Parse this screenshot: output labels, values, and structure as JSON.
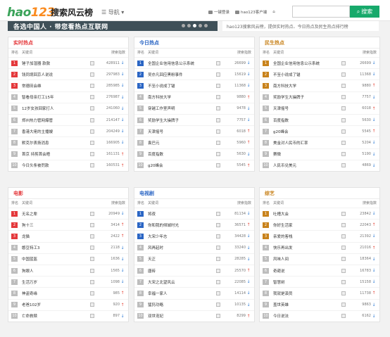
{
  "header": {
    "logo_text": "hao",
    "logo_number": "123",
    "site_title": "搜索风云榜",
    "nav_label": "导航",
    "links": [
      "一键登录",
      "hao123客户端"
    ],
    "search_placeholder": "",
    "search_button": "搜索"
  },
  "banner": {
    "text": "各选中国人 · 带您看热点互联网"
  },
  "notice": {
    "text": "hao123搜索风云榜，提供实时热点、今日热点及民生热点排行榜"
  },
  "columns": {
    "rank": "排名",
    "keyword": "关键词",
    "index": "搜索指数"
  },
  "colors": {
    "up": "#e64a3c",
    "down": "#2e7bd6",
    "red_theme": "#e4393c",
    "blue_theme": "#2a65c4",
    "gold_theme": "#c8821b"
  },
  "panels": [
    {
      "title": "实时热点",
      "theme": "#e4393c",
      "rows": [
        {
          "rank": "1",
          "keyword": "锤子加湿器 款款",
          "value": "428911",
          "trend": "down"
        },
        {
          "rank": "2",
          "keyword": "钱同境回京人说说",
          "value": "297983",
          "trend": "down"
        },
        {
          "rank": "3",
          "keyword": "常德田会维",
          "value": "285985",
          "trend": "down"
        },
        {
          "rank": "4",
          "keyword": "智看母亲打工15年",
          "value": "276987",
          "trend": "down"
        },
        {
          "rank": "5",
          "keyword": "12岁女孩回家打人",
          "value": "241060",
          "trend": "down"
        },
        {
          "rank": "6",
          "keyword": "郑州热力管网爆管",
          "value": "214147",
          "trend": "down"
        },
        {
          "rank": "7",
          "keyword": "香港大佬的主播嫂",
          "value": "204249",
          "trend": "down"
        },
        {
          "rank": "8",
          "keyword": "默克尔表扬消息",
          "value": "166905",
          "trend": "down"
        },
        {
          "rank": "9",
          "keyword": "首京 持剪首会晤",
          "value": "161131",
          "trend": "up"
        },
        {
          "rank": "10",
          "keyword": "今日头条被罚款",
          "value": "160531",
          "trend": "up"
        }
      ]
    },
    {
      "title": "今日热点",
      "theme": "#2a65c4",
      "rows": [
        {
          "rank": "1",
          "keyword": "全国企业信用信息公示系统",
          "value": "26699",
          "trend": "down"
        },
        {
          "rank": "2",
          "keyword": "吴亦凡回应黑粉事件",
          "value": "15619",
          "trend": "down"
        },
        {
          "rank": "3",
          "keyword": "不至小说成了锚",
          "value": "11368",
          "trend": "down"
        },
        {
          "rank": "4",
          "keyword": "南方科技大学",
          "value": "9880",
          "trend": "up"
        },
        {
          "rank": "5",
          "keyword": "穿越工作室声明",
          "value": "9478",
          "trend": "down"
        },
        {
          "rank": "6",
          "keyword": "奖励学生大操牌子",
          "value": "7757",
          "trend": "down"
        },
        {
          "rank": "7",
          "keyword": "天津摇号",
          "value": "6018",
          "trend": "up"
        },
        {
          "rank": "8",
          "keyword": "袁巴元",
          "value": "5960",
          "trend": "up"
        },
        {
          "rank": "9",
          "keyword": "百度指数",
          "value": "5630",
          "trend": "down"
        },
        {
          "rank": "10",
          "keyword": "g20峰会",
          "value": "5545",
          "trend": "up"
        }
      ]
    },
    {
      "title": "民生热点",
      "theme": "#c8821b",
      "rows": [
        {
          "rank": "1",
          "keyword": "全国企业信用信息公示系统",
          "value": "26699",
          "trend": "down"
        },
        {
          "rank": "2",
          "keyword": "不至小说成了锚",
          "value": "11368",
          "trend": "down"
        },
        {
          "rank": "3",
          "keyword": "南方科技大学",
          "value": "9880",
          "trend": "up"
        },
        {
          "rank": "4",
          "keyword": "奖励学生大操牌子",
          "value": "7757",
          "trend": "down"
        },
        {
          "rank": "5",
          "keyword": "天津摇号",
          "value": "6018",
          "trend": "up"
        },
        {
          "rank": "6",
          "keyword": "百度指数",
          "value": "5630",
          "trend": "down"
        },
        {
          "rank": "7",
          "keyword": "g20峰会",
          "value": "5545",
          "trend": "up"
        },
        {
          "rank": "8",
          "keyword": "美金对人民币的汇率",
          "value": "5204",
          "trend": "down"
        },
        {
          "rank": "9",
          "keyword": "赛微",
          "value": "5190",
          "trend": "down"
        },
        {
          "rank": "10",
          "keyword": "人民币兑美元",
          "value": "4869",
          "trend": "down"
        }
      ]
    },
    {
      "title": "电影",
      "theme": "#e4393c",
      "rows": [
        {
          "rank": "1",
          "keyword": "无名之辈",
          "value": "20949",
          "trend": "down"
        },
        {
          "rank": "2",
          "keyword": "狗十三",
          "value": "3414",
          "trend": "up"
        },
        {
          "rank": "3",
          "keyword": "龙猫",
          "value": "2422",
          "trend": "up"
        },
        {
          "rank": "4",
          "keyword": "憨豆特工3",
          "value": "2118",
          "trend": "down"
        },
        {
          "rank": "5",
          "keyword": "中国蓝盔",
          "value": "1636",
          "trend": "down"
        },
        {
          "rank": "6",
          "keyword": "狗眼人",
          "value": "1565",
          "trend": "down"
        },
        {
          "rank": "7",
          "keyword": "生活万岁",
          "value": "1098",
          "trend": "down"
        },
        {
          "rank": "8",
          "keyword": "神盗奇缘",
          "value": "985",
          "trend": "up"
        },
        {
          "rank": "9",
          "keyword": "老爸102岁",
          "value": "920",
          "trend": "up"
        },
        {
          "rank": "10",
          "keyword": "亡命救赎",
          "value": "897",
          "trend": "down"
        }
      ]
    },
    {
      "title": "电视剧",
      "theme": "#2a65c4",
      "rows": [
        {
          "rank": "1",
          "keyword": "将夜",
          "value": "81134",
          "trend": "down"
        },
        {
          "rank": "2",
          "keyword": "你和我的倾城时光",
          "value": "36571",
          "trend": "up"
        },
        {
          "rank": "3",
          "keyword": "大宋少年志",
          "value": "34428",
          "trend": "down"
        },
        {
          "rank": "4",
          "keyword": "风再起时",
          "value": "33240",
          "trend": "down"
        },
        {
          "rank": "5",
          "keyword": "天正",
          "value": "28285",
          "trend": "down"
        },
        {
          "rank": "6",
          "keyword": "唐砖",
          "value": "25570",
          "trend": "up"
        },
        {
          "rank": "7",
          "keyword": "大宋之北望风云",
          "value": "22085",
          "trend": "down"
        },
        {
          "rank": "8",
          "keyword": "幸福一家人",
          "value": "14114",
          "trend": "down"
        },
        {
          "rank": "9",
          "keyword": "猛犸功略",
          "value": "10135",
          "trend": "down"
        },
        {
          "rank": "10",
          "keyword": "双世宠妃",
          "value": "8299",
          "trend": "up"
        }
      ]
    },
    {
      "title": "综艺",
      "theme": "#c8821b",
      "rows": [
        {
          "rank": "1",
          "keyword": "吐槽大会",
          "value": "23842",
          "trend": "down"
        },
        {
          "rank": "2",
          "keyword": "你好生活家",
          "value": "22043",
          "trend": "up"
        },
        {
          "rank": "3",
          "keyword": "亲爱的客栈",
          "value": "21392",
          "trend": "down"
        },
        {
          "rank": "4",
          "keyword": "快乐再出发",
          "value": "21016",
          "trend": "up"
        },
        {
          "rank": "5",
          "keyword": "风味人间",
          "value": "18364",
          "trend": "down"
        },
        {
          "rank": "6",
          "keyword": "奇葩说",
          "value": "16783",
          "trend": "down"
        },
        {
          "rank": "7",
          "keyword": "智慧树",
          "value": "15158",
          "trend": "down"
        },
        {
          "rank": "8",
          "keyword": "我就是演员",
          "value": "11738",
          "trend": "up"
        },
        {
          "rank": "9",
          "keyword": "盖世英雄",
          "value": "9863",
          "trend": "down"
        },
        {
          "rank": "10",
          "keyword": "今日说法",
          "value": "6162",
          "trend": "down"
        }
      ]
    }
  ]
}
